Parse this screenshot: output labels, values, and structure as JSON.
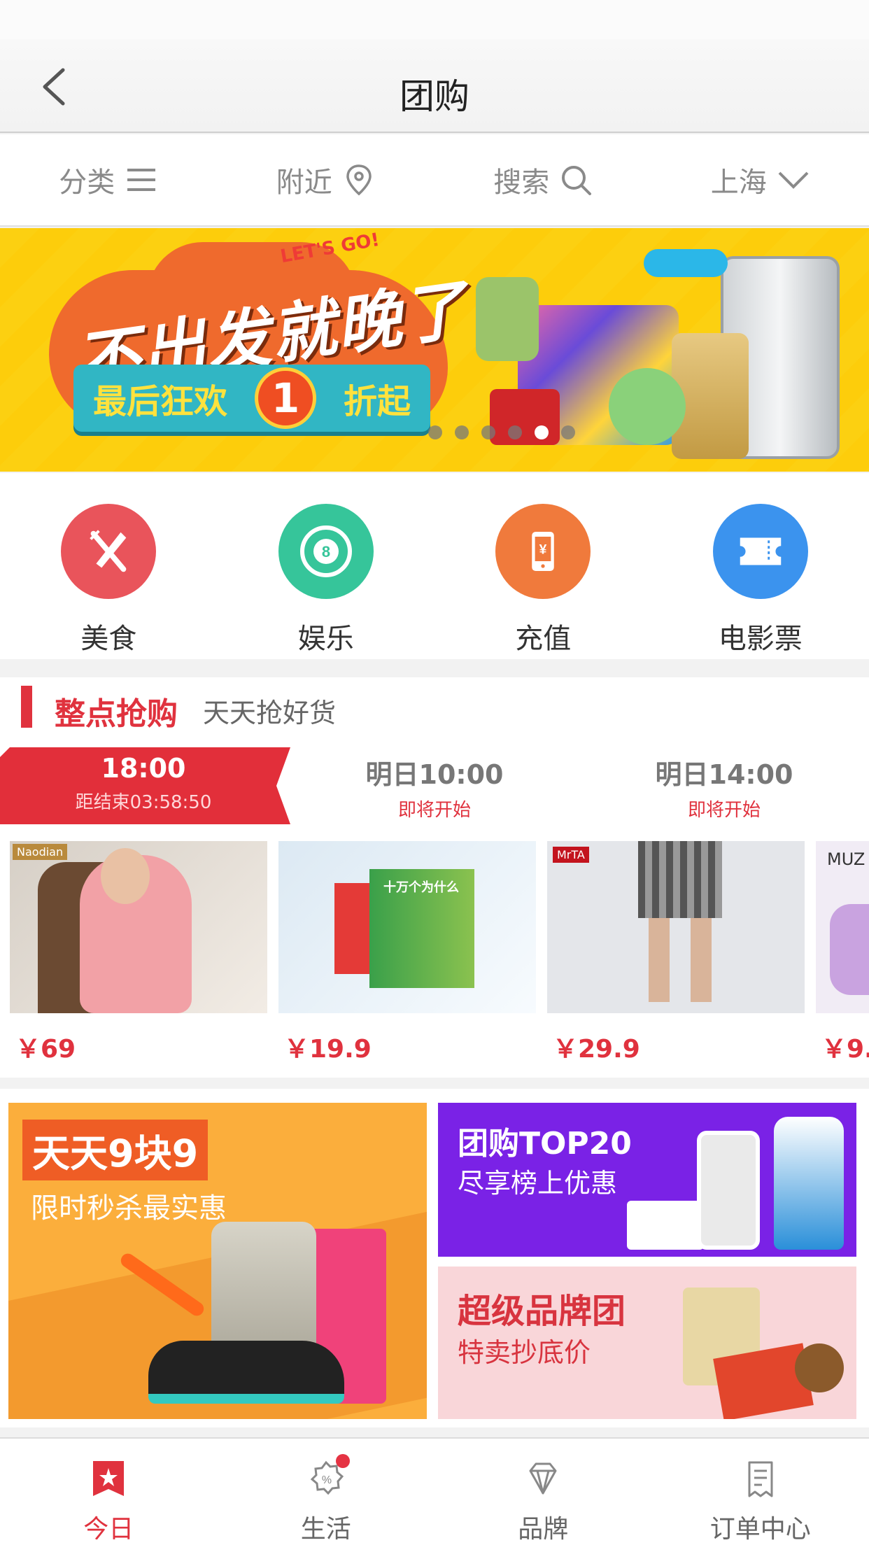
{
  "header": {
    "title": "团购"
  },
  "subnav": [
    {
      "label": "分类",
      "icon": "menu-icon"
    },
    {
      "label": "附近",
      "icon": "location-pin-icon"
    },
    {
      "label": "搜索",
      "icon": "search-icon"
    },
    {
      "label": "上海",
      "icon": "chevron-down-icon"
    }
  ],
  "banner": {
    "headline": "不出发就晚了",
    "ribbon_left": "最后狂欢",
    "ribbon_num": "1",
    "ribbon_right": "折起",
    "tag": "LET'S GO!",
    "dot_count": 6,
    "active_dot": 5
  },
  "categories": [
    {
      "label": "美食",
      "icon": "fork-knife-icon",
      "color": "#e9545b"
    },
    {
      "label": "娱乐",
      "icon": "billiard-ball-icon",
      "color": "#36c59a"
    },
    {
      "label": "充值",
      "icon": "phone-recharge-icon",
      "color": "#f07a3c"
    },
    {
      "label": "电影票",
      "icon": "movie-ticket-icon",
      "color": "#3b93ee"
    }
  ],
  "flash": {
    "title": "整点抢购",
    "subtitle": "天天抢好货",
    "slots": [
      {
        "time": "18:00",
        "status": "距结束03:58:50"
      },
      {
        "time": "明日10:00",
        "status": "即将开始"
      },
      {
        "time": "明日14:00",
        "status": "即将开始"
      }
    ],
    "products": [
      {
        "price": "￥69",
        "badge": "Naodian"
      },
      {
        "price": "￥19.9",
        "badge": "十万个为什么"
      },
      {
        "price": "￥29.9",
        "badge": "MrTA"
      },
      {
        "price": "￥9.",
        "badge": "MUZ"
      }
    ]
  },
  "promos": {
    "p1_tag": "天天9块9",
    "p1_sub": "限时秒杀最实惠",
    "p2_t1": "团购TOP20",
    "p2_t2": "尽享榜上优惠",
    "p3_t1": "超级品牌团",
    "p3_t2": "特卖抄底价"
  },
  "tabbar": [
    {
      "label": "今日",
      "icon": "star-badge-icon",
      "active": true
    },
    {
      "label": "生活",
      "icon": "discount-gear-icon",
      "badge": true
    },
    {
      "label": "品牌",
      "icon": "diamond-icon"
    },
    {
      "label": "订单中心",
      "icon": "order-list-icon"
    }
  ],
  "colors": {
    "accent": "#e0323e",
    "banner_bg": "#fcd011"
  }
}
